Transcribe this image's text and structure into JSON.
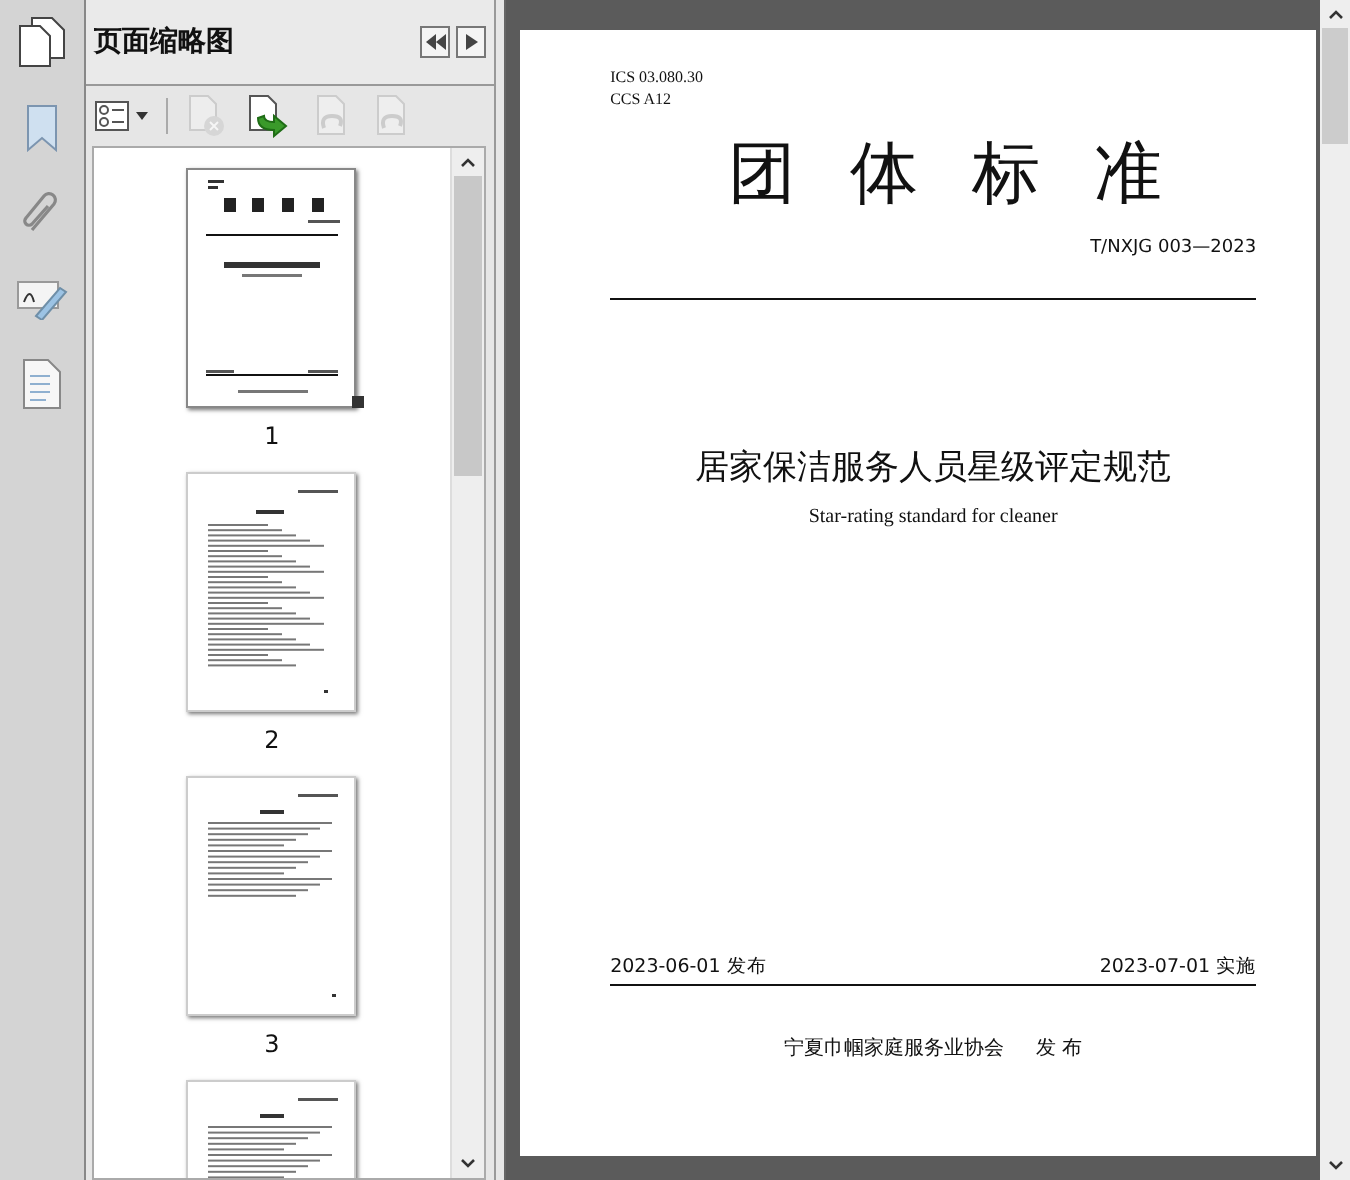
{
  "panel": {
    "title": "页面缩略图"
  },
  "toolbar": [
    {
      "kind": "options",
      "disabled": false
    },
    {
      "kind": "delete",
      "disabled": true
    },
    {
      "kind": "insert",
      "disabled": false
    },
    {
      "kind": "undo",
      "disabled": true
    },
    {
      "kind": "redo",
      "disabled": true
    }
  ],
  "thumbnails": [
    {
      "label": "1",
      "kind": "cover",
      "selected": true
    },
    {
      "label": "2",
      "kind": "toc",
      "selected": false
    },
    {
      "label": "3",
      "kind": "text",
      "selected": false
    },
    {
      "kind": "text",
      "selected": false
    }
  ],
  "document": {
    "ics": "ICS  03.080.30",
    "ccs": "CCS  A12",
    "heading": [
      "团",
      "体",
      "标",
      "准"
    ],
    "code": "T/NXJG 003—2023",
    "title": "居家保洁服务人员星级评定规范",
    "subtitle": "Star-rating standard for cleaner",
    "issue_date": "2023-06-01 发布",
    "effective_date": "2023-07-01 实施",
    "publisher": "宁夏巾帼家庭服务业协会",
    "publish_word": "发  布"
  }
}
